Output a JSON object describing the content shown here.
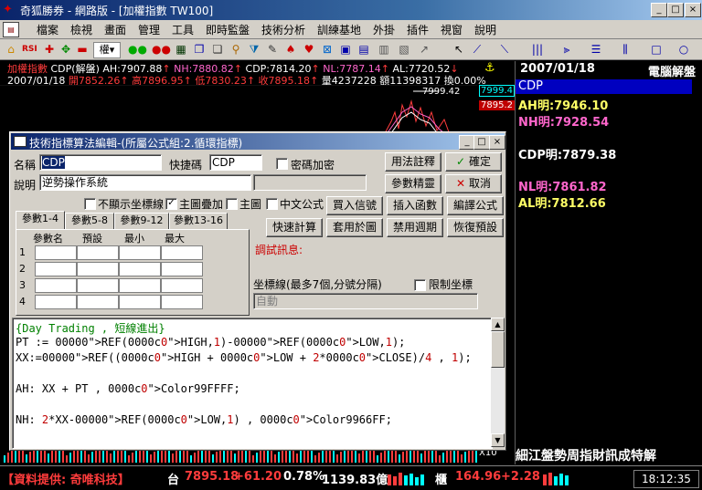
{
  "window": {
    "title": "奇狐勝券 - 網路版 - [加權指數 TW100]",
    "min": "_",
    "max": "□",
    "close": "×"
  },
  "menu": [
    "檔案",
    "檢視",
    "畫面",
    "管理",
    "工具",
    "即時監盤",
    "技術分析",
    "訓練基地",
    "外掛",
    "插件",
    "視窗",
    "說明"
  ],
  "chart_header": {
    "line1": {
      "name": "加權指數",
      "indicator": "CDP(解盤)",
      "ah": "AH:7907.88",
      "nh": "NH:7880.82",
      "cdp": "CDP:7814.20",
      "nl": "NL:7787.14",
      "al": "AL:7720.52"
    },
    "line2": {
      "date": "2007/01/18",
      "open": "開7852.26",
      "high": "高7896.95",
      "low": "低7830.23",
      "close": "收7895.18",
      "vol": "量4237228",
      "amount": "額11398317",
      "turnover": "換0.00%"
    },
    "peak_label": "7999.42"
  },
  "axis": {
    "top": "7999.4",
    "current": "7895.2",
    "bottom": "X10"
  },
  "right_panel": {
    "date": "2007/01/18",
    "title": "電腦解盤",
    "selected": "CDP",
    "ah": "AH明:7946.10",
    "nh": "NH明:7928.54",
    "cdp": "CDP明:7879.38",
    "nl": "NL明:7861.82",
    "al": "AL明:7812.66",
    "bottom_text": "細江盤勢周指財訊成特解"
  },
  "dialog": {
    "title": "技術指標算法編輯-(所屬公式組:2.循環指標)",
    "name_label": "名稱",
    "name_value": "CDP",
    "shortcut_label": "快捷碼",
    "shortcut_value": "CDP",
    "password_label": "密碼加密",
    "desc_label": "說明",
    "desc_value": "逆勢操作系統",
    "opt_hide_axis": "不顯示坐標線",
    "opt_main_overlay": "主圖疊加",
    "opt_main": "主圖",
    "opt_chinese": "中文公式",
    "btn_usage": "用法註釋",
    "btn_confirm": "確定",
    "btn_param": "參數精靈",
    "btn_cancel": "取消",
    "btn_buy_signal": "買入信號",
    "btn_insert_func": "插入函數",
    "btn_compile": "編譯公式",
    "btn_quick_calc": "快速計算",
    "btn_apply_chart": "套用於圖",
    "btn_disable_period": "禁用週期",
    "btn_restore": "恢復預設",
    "tabs": [
      "參數1-4",
      "參數5-8",
      "參數9-12",
      "參數13-16"
    ],
    "grid_headers": [
      "參數名",
      "預設",
      "最小",
      "最大"
    ],
    "rows": [
      "1",
      "2",
      "3",
      "4"
    ],
    "debug_label": "調試訊息:",
    "axis_label": "坐標線(最多7個,分號分隔)",
    "limit_label": "限制坐標",
    "axis_value": "自動",
    "code": [
      "{Day Trading , 短線進出}",
      "PT := REF(HIGH,1)-REF(LOW,1);",
      "XX:=REF((HIGH + LOW + 2*CLOSE)/4 , 1);",
      "",
      "AH: XX + PT , Color99FFFF;",
      "",
      "NH: 2*XX-REF(LOW,1) , Color9966FF;"
    ]
  },
  "status": {
    "provider": "【資料提供: 奇唯科技】",
    "tai": "台",
    "tai_price": "7895.18",
    "tai_change": "+61.20",
    "tai_pct": "0.78%",
    "tai_amount": "1139.83億",
    "gui": "櫃",
    "gui_price": "164.96",
    "gui_change": "+2.28",
    "clock": "18:12:35"
  },
  "colors": {
    "titlebar": "#0a246a",
    "dialog_bg": "#d4d0c8",
    "up": "#ff3c3c",
    "highlight": "#0000c0"
  }
}
